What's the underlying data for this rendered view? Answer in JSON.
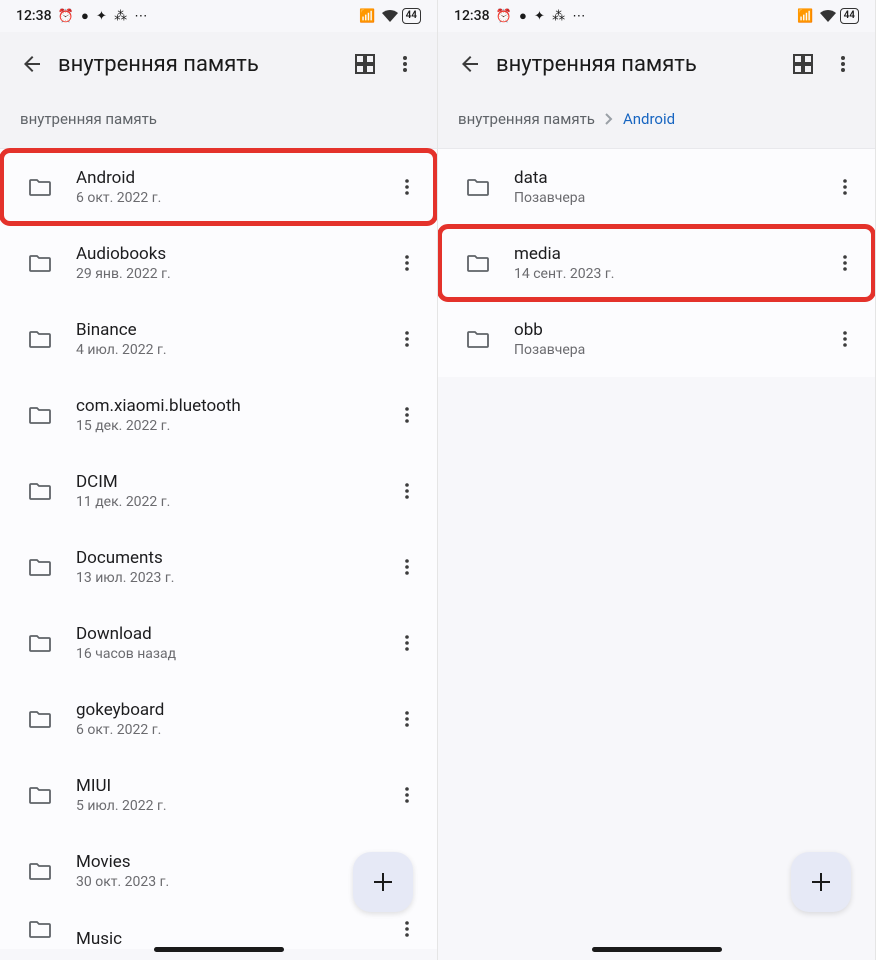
{
  "status": {
    "time": "12:38",
    "battery": "44"
  },
  "left": {
    "title": "внутренняя память",
    "breadcrumbs": [
      {
        "label": "внутренняя память",
        "active": false
      }
    ],
    "items": [
      {
        "name": "Android",
        "date": "6 окт. 2022 г.",
        "highlighted": true
      },
      {
        "name": "Audiobooks",
        "date": "29 янв. 2022 г.",
        "highlighted": false
      },
      {
        "name": "Binance",
        "date": "4 июл. 2022 г.",
        "highlighted": false
      },
      {
        "name": "com.xiaomi.bluetooth",
        "date": "15 дек. 2022 г.",
        "highlighted": false
      },
      {
        "name": "DCIM",
        "date": "11 дек. 2022 г.",
        "highlighted": false
      },
      {
        "name": "Documents",
        "date": "13 июл. 2023 г.",
        "highlighted": false
      },
      {
        "name": "Download",
        "date": "16 часов назад",
        "highlighted": false
      },
      {
        "name": "gokeyboard",
        "date": "6 окт. 2022 г.",
        "highlighted": false
      },
      {
        "name": "MIUI",
        "date": "5 июл. 2022 г.",
        "highlighted": false
      },
      {
        "name": "Movies",
        "date": "30 окт. 2023 г.",
        "highlighted": false
      },
      {
        "name": "Music",
        "date": "",
        "highlighted": false,
        "partial": true
      }
    ]
  },
  "right": {
    "title": "внутренняя память",
    "breadcrumbs": [
      {
        "label": "внутренняя память",
        "active": false
      },
      {
        "label": "Android",
        "active": true
      }
    ],
    "items": [
      {
        "name": "data",
        "date": "Позавчера",
        "highlighted": false
      },
      {
        "name": "media",
        "date": "14 сент. 2023 г.",
        "highlighted": true
      },
      {
        "name": "obb",
        "date": "Позавчера",
        "highlighted": false
      }
    ]
  }
}
